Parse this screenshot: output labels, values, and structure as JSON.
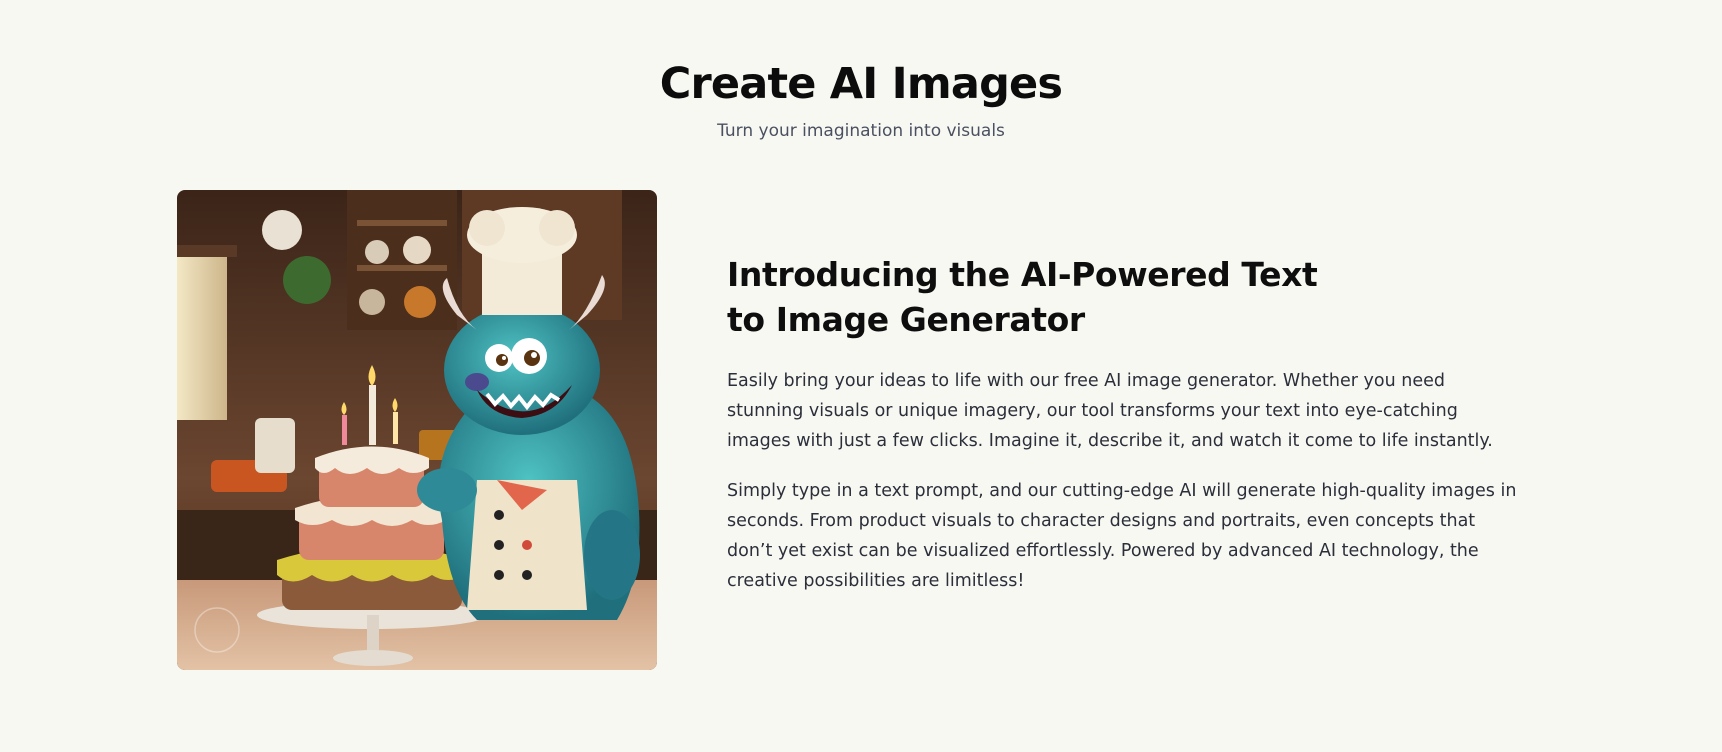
{
  "header": {
    "title": "Create AI Images",
    "subtitle": "Turn your imagination into visuals"
  },
  "feature": {
    "image_alt": "Blue furry monster chef next to a birthday cake",
    "heading": "Introducing the AI-Powered Text to Image Generator",
    "paragraphs": [
      "Easily bring your ideas to life with our free AI image generator. Whether you need stunning visuals or unique imagery, our tool transforms your text into eye-catching images with just a few clicks. Imagine it, describe it, and watch it come to life instantly.",
      "Simply type in a text prompt, and our cutting-edge AI will generate high-quality images in seconds. From product visuals to character designs and portraits, even concepts that don’t yet exist can be visualized effortlessly. Powered by advanced AI technology, the creative possibilities are limitless!"
    ]
  },
  "colors": {
    "background": "#f8f8f3",
    "title": "#0c0c0c",
    "subtitle": "#4a5060",
    "body_text": "#2b2f3a"
  }
}
